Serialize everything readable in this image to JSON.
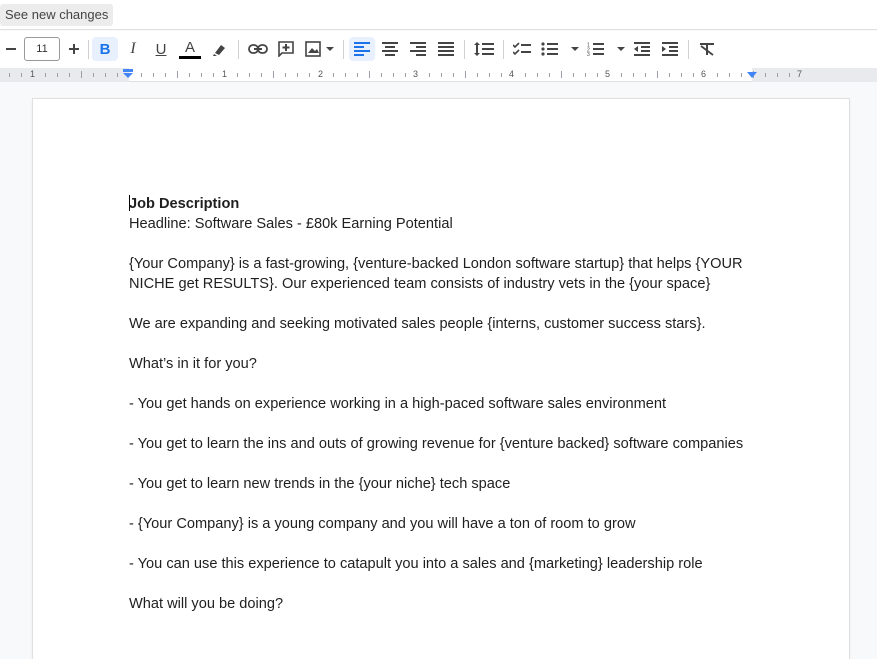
{
  "topbar": {
    "see_changes": "See new changes"
  },
  "toolbar": {
    "font_size": "11",
    "font_size_minus": "−",
    "font_size_plus": "+",
    "bold_label": "B",
    "italic_label": "I",
    "underline_label": "U",
    "text_color_label": "A",
    "icons": [
      "minus-icon",
      "plus-icon",
      "bold-icon",
      "italic-icon",
      "underline-icon",
      "text-color-icon",
      "highlight-icon",
      "link-icon",
      "add-comment-icon",
      "insert-image-icon",
      "align-left-icon",
      "align-center-icon",
      "align-right-icon",
      "align-justify-icon",
      "line-spacing-icon",
      "checklist-icon",
      "bulleted-list-icon",
      "numbered-list-icon",
      "decrease-indent-icon",
      "increase-indent-icon",
      "clear-formatting-icon"
    ],
    "text_color": "#000000",
    "active_color": "#1a73e8"
  },
  "ruler": {
    "numbers": [
      "1",
      "1",
      "2",
      "3",
      "4",
      "5",
      "6",
      "7"
    ]
  },
  "document": {
    "title": "Job Description",
    "title_first_letter": "J",
    "title_rest": "ob Description",
    "headline": "Headline: Software Sales - £80k Earning Potential",
    "para1_line1": "{Your Company} is a fast-growing, {venture-backed London software startup} that helps {YOUR",
    "para1_line2": "NICHE get RESULTS}. Our experienced team consists of industry vets in the {your space}",
    "para2": "We are expanding and seeking motivated sales people {interns, customer success stars}.",
    "question1": "What’s in it for you?",
    "bullet1": "- You get hands on experience working in a high-paced software sales environment",
    "bullet2": "- You get to learn the ins and outs of growing revenue for {venture backed} software companies",
    "bullet3": "- You get to learn new trends in the {your niche} tech space",
    "bullet4": "- {Your Company} is a young company and you will have a ton of room to grow",
    "bullet5": "- You can use this experience to catapult you into a sales and {marketing} leadership role",
    "question2": "What will you be doing?"
  }
}
